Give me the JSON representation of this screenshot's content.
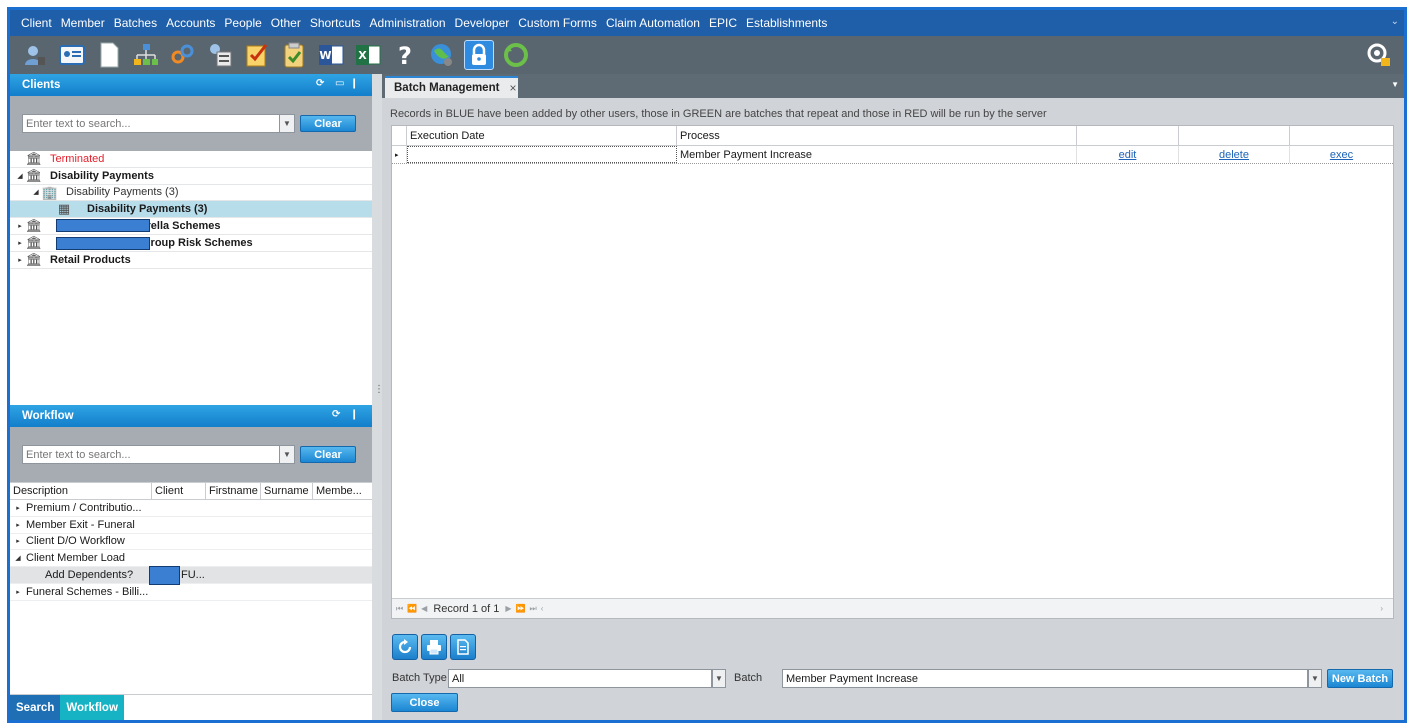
{
  "menu": [
    "Client",
    "Member",
    "Batches",
    "Accounts",
    "People",
    "Other",
    "Shortcuts",
    "Administration",
    "Developer",
    "Custom Forms",
    "Claim Automation",
    "EPIC",
    "Establishments"
  ],
  "toolbar_icons": [
    "user-icon",
    "id-card-icon",
    "document-icon",
    "org-chart-icon",
    "links-icon",
    "server-icon",
    "checklist-icon",
    "clipboard-check-icon",
    "word-icon",
    "excel-icon",
    "help-icon",
    "globe-icon",
    "lock-icon",
    "refresh-icon"
  ],
  "clients_panel": {
    "title": "Clients",
    "search_placeholder": "Enter text to search...",
    "clear_label": "Clear",
    "tree": [
      {
        "label": "Terminated",
        "color": "#e3212d"
      },
      {
        "label": "Disability Payments"
      },
      {
        "label": "Disability Payments (3)"
      },
      {
        "label": "Disability Payments (3)"
      },
      {
        "label": "mbrella Schemes"
      },
      {
        "label": "Group Risk Schemes"
      },
      {
        "label": "Retail Products"
      }
    ]
  },
  "workflow_panel": {
    "title": "Workflow",
    "search_placeholder": "Enter text to search...",
    "clear_label": "Clear",
    "columns": [
      "Description",
      "Client",
      "Firstname",
      "Surname",
      "Membe..."
    ],
    "rows": [
      {
        "label": "Premium / Contributio..."
      },
      {
        "label": "Member Exit - Funeral"
      },
      {
        "label": "Client D/O Workflow"
      },
      {
        "label": "Client Member Load"
      },
      {
        "label": "Add Dependents?",
        "client": "FU..."
      },
      {
        "label": "Funeral Schemes - Billi..."
      }
    ]
  },
  "bottom_tabs": [
    "Search",
    "Workflow"
  ],
  "batch": {
    "tab_title": "Batch Management",
    "tab_close": "×",
    "info": "Records in BLUE have been added by other users, those in GREEN are batches that repeat and those in RED will be run by the server",
    "columns": [
      "Execution Date",
      "Process"
    ],
    "rows": [
      {
        "execution_date": "",
        "process": "Member Payment Increase",
        "edit": "edit",
        "delete": "delete",
        "exec": "exec"
      }
    ],
    "record_text": "Record 1 of 1",
    "batch_type_label": "Batch Type",
    "batch_type_value": "All",
    "batch_label": "Batch",
    "batch_value": "Member Payment Increase",
    "new_batch_label": "New Batch",
    "close_label": "Close"
  }
}
